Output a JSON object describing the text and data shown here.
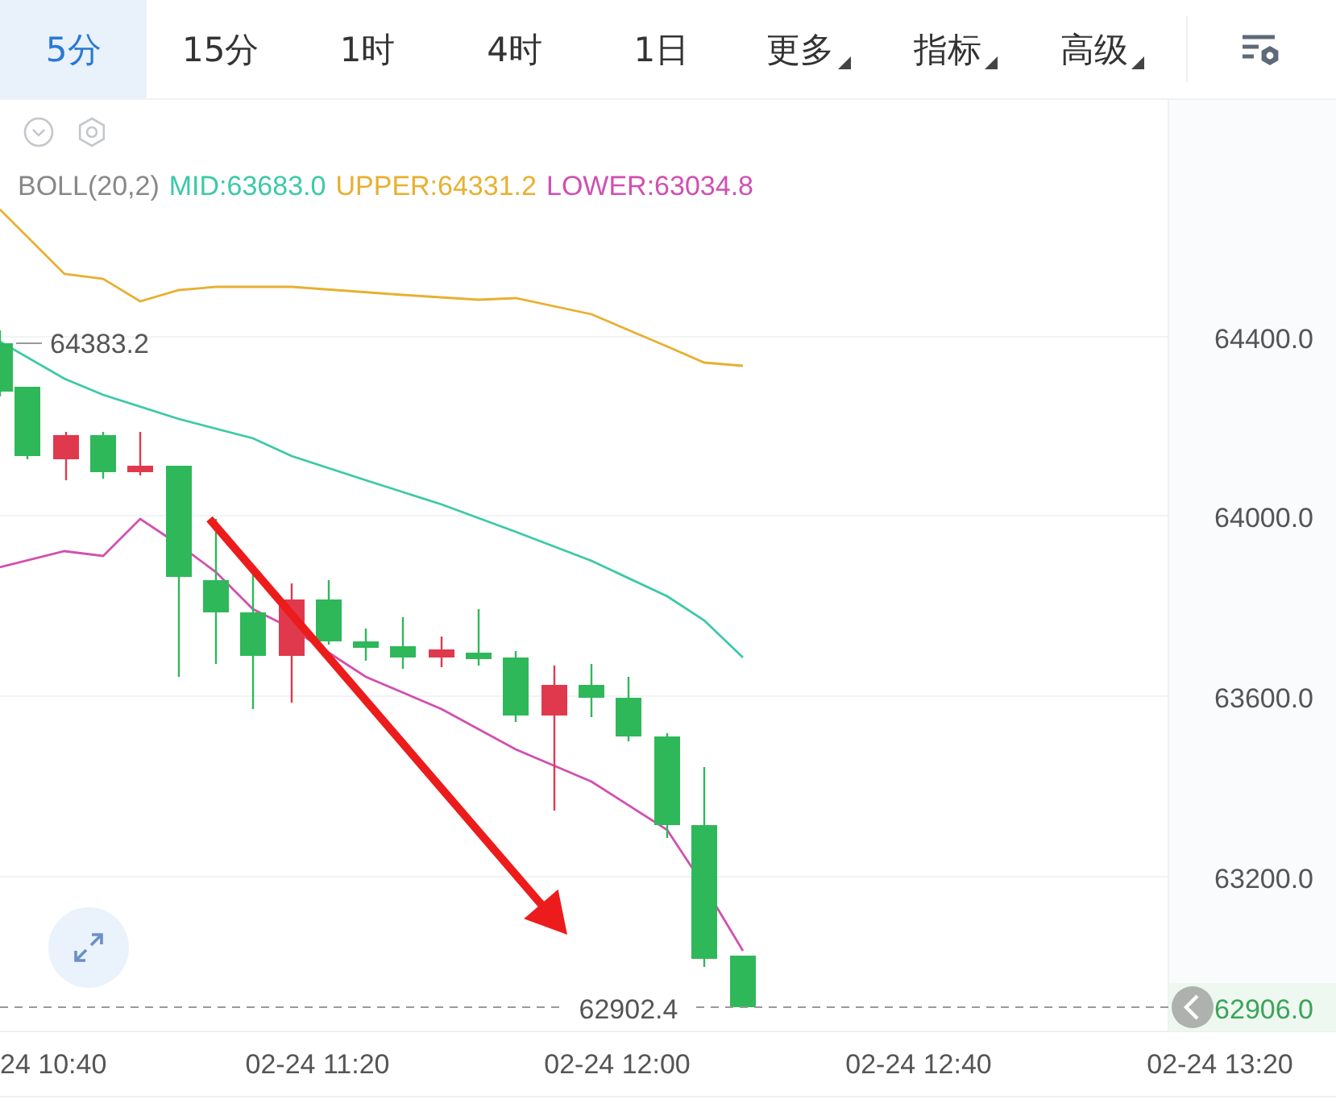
{
  "tabs": [
    {
      "label": "5分",
      "selected": true,
      "kind": "plain"
    },
    {
      "label": "15分",
      "selected": false,
      "kind": "plain"
    },
    {
      "label": "1时",
      "selected": false,
      "kind": "plain"
    },
    {
      "label": "4时",
      "selected": false,
      "kind": "plain"
    },
    {
      "label": "1日",
      "selected": false,
      "kind": "plain"
    },
    {
      "label": "更多",
      "selected": false,
      "kind": "menu"
    },
    {
      "label": "指标",
      "selected": false,
      "kind": "menu"
    },
    {
      "label": "高级",
      "selected": false,
      "kind": "menu"
    }
  ],
  "indicator": {
    "name": "BOLL(20,2)",
    "mid": "MID:63683.0",
    "upper": "UPPER:64331.2",
    "lower": "LOWER:63034.8"
  },
  "chart": {
    "high_label": "64383.2",
    "low_label": "62902.4"
  },
  "price_axis": {
    "ticks": [
      "64400.0",
      "64000.0",
      "63600.0",
      "63200.0"
    ],
    "last_price": "62906.0"
  },
  "time_axis": [
    "24 10:40",
    "02-24 11:20",
    "02-24 12:00",
    "02-24 12:40",
    "02-24 13:20"
  ]
}
